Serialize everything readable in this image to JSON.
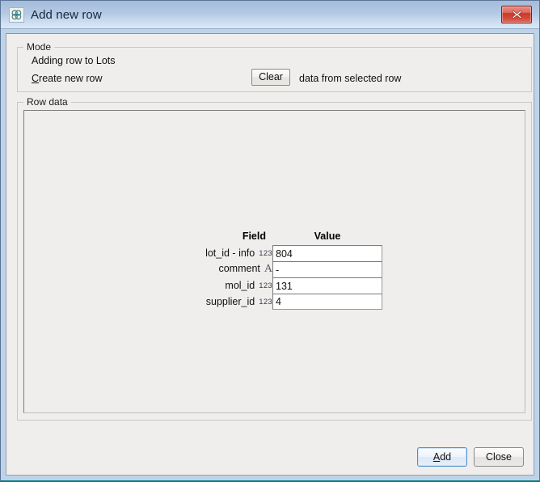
{
  "window": {
    "title": "Add new row",
    "icon": "molecule-icon",
    "close_label": "Close window",
    "frame_color": "#bdd3ea",
    "titlebar_color": "#b4c9e3",
    "accent_bottom_color": "#0a7b85"
  },
  "mode": {
    "legend": "Mode",
    "adding_text": "Adding row to Lots",
    "create_row_prefix": "C",
    "create_row_rest": "reate new row",
    "clear_button": "Clear",
    "clear_suffix": "data from selected row"
  },
  "row_data": {
    "legend": "Row data",
    "headers": {
      "field": "Field",
      "value": "Value"
    },
    "rows": [
      {
        "label": "lot_id - info",
        "type_icon": "123",
        "type": "numeric",
        "value": "804"
      },
      {
        "label": "comment",
        "type_icon": "A",
        "type": "alpha",
        "value": "-"
      },
      {
        "label": "mol_id",
        "type_icon": "123",
        "type": "numeric",
        "value": "131"
      },
      {
        "label": "supplier_id",
        "type_icon": "123",
        "type": "numeric",
        "value": "4"
      }
    ]
  },
  "footer": {
    "add_prefix": "A",
    "add_rest": "dd",
    "add_label": "Add",
    "close_label": "Close"
  }
}
